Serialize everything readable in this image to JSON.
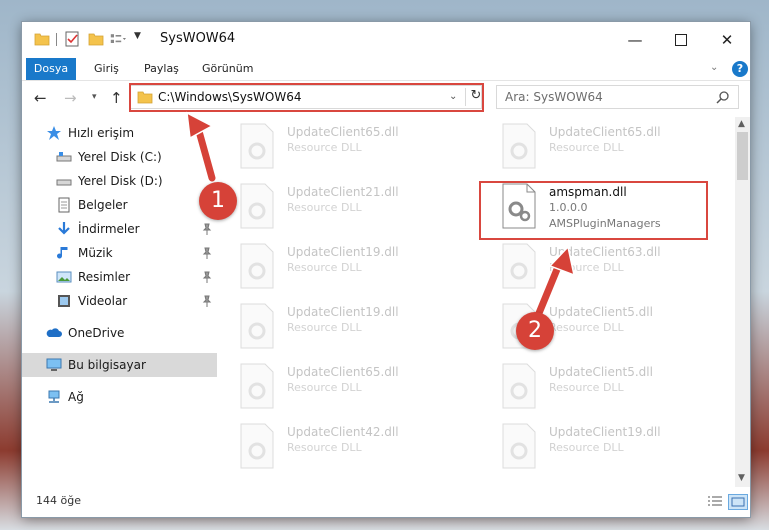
{
  "window": {
    "title": "SysWOW64",
    "controls": {
      "minimize_icon": "minimize-icon",
      "maximize_icon": "maximize-icon",
      "close_icon": "close-icon"
    }
  },
  "ribbon": {
    "tabs": [
      "Dosya",
      "Giriş",
      "Paylaş",
      "Görünüm"
    ],
    "help_label": "?",
    "accent_color": "#1979ca"
  },
  "address": {
    "path": "C:\\Windows\\SysWOW64",
    "search_placeholder": "Ara: SysWOW64"
  },
  "sidebar": {
    "items": [
      {
        "label": "Hızlı erişim",
        "icon": "star-icon",
        "pinned": false
      },
      {
        "label": "Yerel Disk (C:)",
        "icon": "drive-icon",
        "pinned": true
      },
      {
        "label": "Yerel Disk (D:)",
        "icon": "drive-icon",
        "pinned": true
      },
      {
        "label": "Belgeler",
        "icon": "documents-icon",
        "pinned": true
      },
      {
        "label": "İndirmeler",
        "icon": "download-icon",
        "pinned": true
      },
      {
        "label": "Müzik",
        "icon": "music-icon",
        "pinned": true
      },
      {
        "label": "Resimler",
        "icon": "pictures-icon",
        "pinned": true
      },
      {
        "label": "Videolar",
        "icon": "video-icon",
        "pinned": true
      },
      {
        "label": "OneDrive",
        "icon": "cloud-icon",
        "pinned": false
      },
      {
        "label": "Bu bilgisayar",
        "icon": "computer-icon",
        "pinned": false,
        "selected": true
      },
      {
        "label": "Ağ",
        "icon": "network-icon",
        "pinned": false
      }
    ]
  },
  "files": {
    "left_column": [
      {
        "name": "UpdateClient65.dll",
        "desc": "Resource DLL"
      },
      {
        "name": "UpdateClient21.dll",
        "desc": "Resource DLL"
      },
      {
        "name": "UpdateClient19.dll",
        "desc": "Resource DLL"
      },
      {
        "name": "UpdateClient19.dll",
        "desc": "Resource DLL"
      },
      {
        "name": "UpdateClient65.dll",
        "desc": "Resource DLL"
      },
      {
        "name": "UpdateClient42.dll",
        "desc": "Resource DLL"
      }
    ],
    "right_column": [
      {
        "name": "UpdateClient65.dll",
        "desc": "Resource DLL"
      },
      {
        "name": "amspman.dll",
        "desc": "1.0.0.0",
        "desc2": "AMSPluginManagers",
        "focused": true
      },
      {
        "name": "UpdateClient63.dll",
        "desc": "Resource DLL"
      },
      {
        "name": "UpdateClient5.dll",
        "desc": "Resource DLL"
      },
      {
        "name": "UpdateClient5.dll",
        "desc": "Resource DLL"
      },
      {
        "name": "UpdateClient19.dll",
        "desc": "Resource DLL"
      }
    ]
  },
  "status": {
    "item_count": "144 öğe"
  },
  "annotations": {
    "badge_1": "1",
    "badge_2": "2",
    "color": "#d64238"
  }
}
